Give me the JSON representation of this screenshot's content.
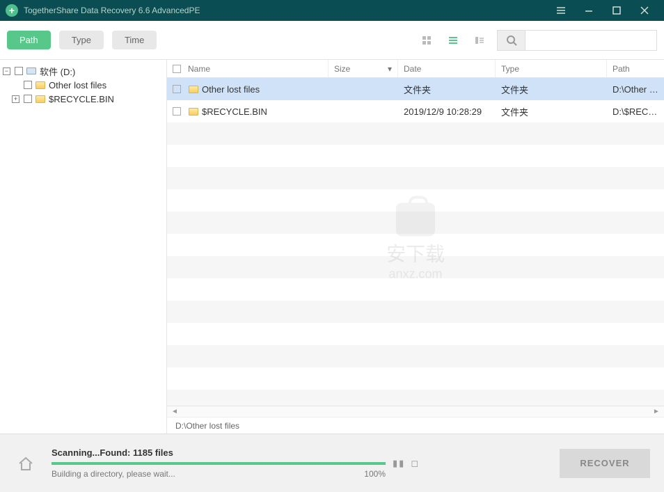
{
  "titlebar": {
    "title": "TogetherShare Data Recovery 6.6 AdvancedPE"
  },
  "tabs": {
    "path": "Path",
    "type": "Type",
    "time": "Time"
  },
  "search": {
    "placeholder": ""
  },
  "tree": {
    "root": "软件 (D:)",
    "children": [
      {
        "name": "Other lost files",
        "expandable": false
      },
      {
        "name": "$RECYCLE.BIN",
        "expandable": true
      }
    ]
  },
  "columns": {
    "name": "Name",
    "size": "Size",
    "date": "Date",
    "type": "Type",
    "path": "Path"
  },
  "rows": [
    {
      "name": "Other lost files",
      "size": "",
      "date": "文件夹",
      "type": "文件夹",
      "path": "D:\\Other lost files",
      "selected": true
    },
    {
      "name": "$RECYCLE.BIN",
      "size": "",
      "date": "2019/12/9 10:28:29",
      "type": "文件夹",
      "path": "D:\\$RECYCLE.BIN",
      "selected": false
    }
  ],
  "watermark": {
    "line1": "安下载",
    "line2": "anxz.com"
  },
  "pathbar": {
    "text": "D:\\Other lost files"
  },
  "footer": {
    "status": "Scanning...Found: 1185 files",
    "sub": "Building a directory, please wait...",
    "percent": "100%",
    "progress": 100,
    "recover": "RECOVER"
  }
}
